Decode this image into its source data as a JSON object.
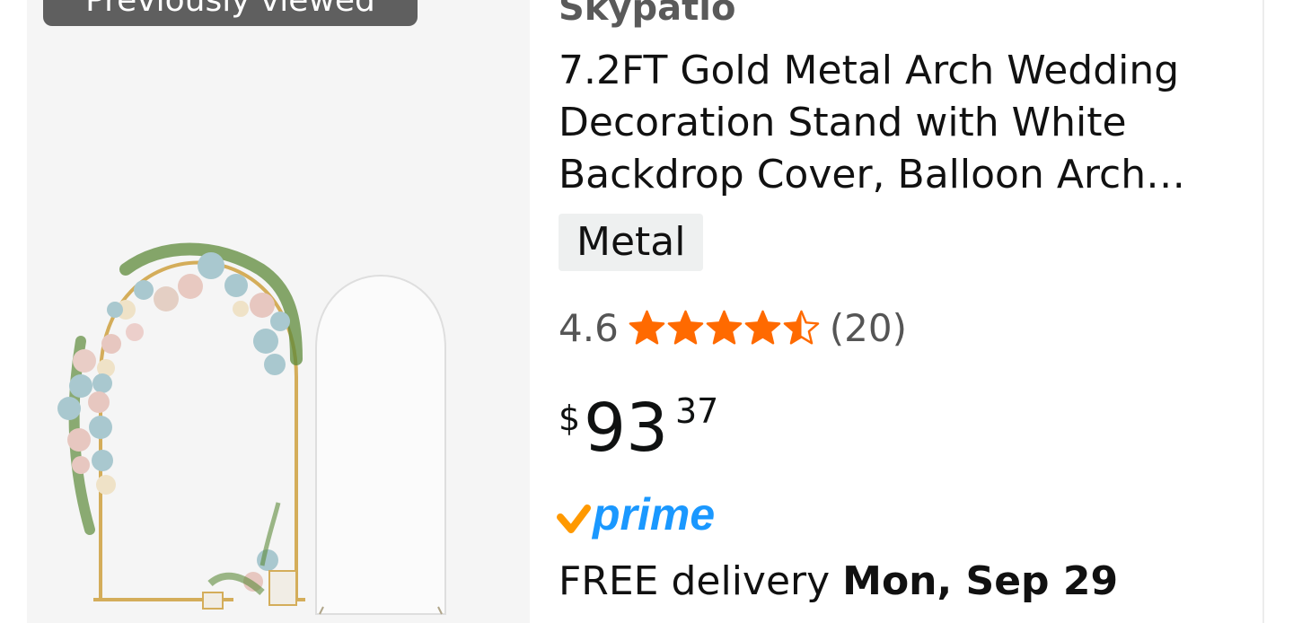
{
  "badge": {
    "label": "Previously viewed"
  },
  "product": {
    "image_alt": "gold-arch-with-balloons-and-white-cover",
    "brand": "Skypatio",
    "title": "7.2FT Gold Metal Arch Wedding Decoration Stand with White Backdrop Cover, Balloon Arch…",
    "material_chip": "Metal",
    "rating": "4.6",
    "rating_value": 4.6,
    "rating_max": 5,
    "review_count": "(20)",
    "price": {
      "currency": "$",
      "whole": "93",
      "fraction": "37"
    },
    "prime_label": "prime",
    "delivery": {
      "prefix": "FREE delivery ",
      "date": "Mon, Sep 29"
    }
  },
  "colors": {
    "star": "#ff6a00",
    "prime_check": "#ff9900",
    "prime_text": "#1a98ff",
    "badge_bg": "#5f5f5f"
  }
}
